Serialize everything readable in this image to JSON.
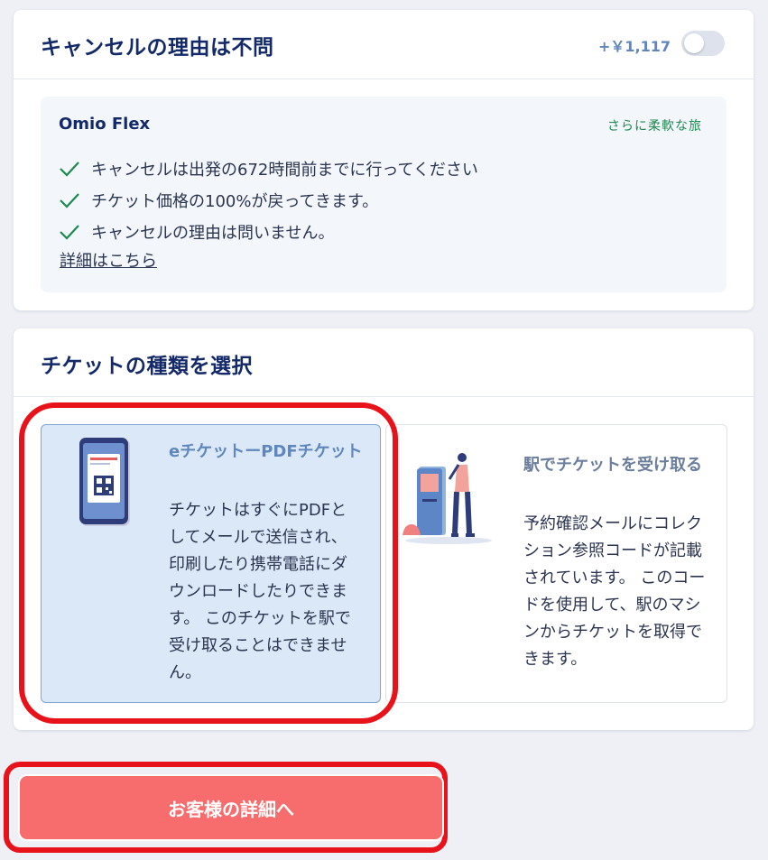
{
  "cancellation": {
    "title": "キャンセルの理由は不問",
    "price": "+￥1,117",
    "toggle_on": false,
    "flex": {
      "name": "Omio Flex",
      "tag": "さらに柔軟な旅",
      "benefits": [
        "キャンセルは出発の672時間前までに行ってください",
        "チケット価格の100%が戻ってきます。",
        "キャンセルの理由は問いません。"
      ],
      "details_link": "詳細はこちら"
    }
  },
  "ticket_type": {
    "title": "チケットの種類を選択",
    "options": [
      {
        "title": "eチケットーPDFチケット",
        "description": "チケットはすぐにPDFとしてメールで送信され、印刷したり携帯電話にダウンロードしたりできます。 このチケットを駅で受け取ることはできません。",
        "selected": true,
        "icon": "phone-qr-ticket-icon"
      },
      {
        "title": "駅でチケットを受け取る",
        "description": "予約確認メールにコレクション参照コードが記載されています。 このコードを使用して、駅のマシンからチケットを取得できます。",
        "selected": false,
        "icon": "ticket-kiosk-icon"
      }
    ]
  },
  "cta": {
    "label": "お客様の詳細へ"
  },
  "colors": {
    "navy": "#132968",
    "accent_blue": "#5f86bd",
    "green": "#1d8a4f",
    "cta": "#f76c6c",
    "highlight": "#e8121b"
  }
}
